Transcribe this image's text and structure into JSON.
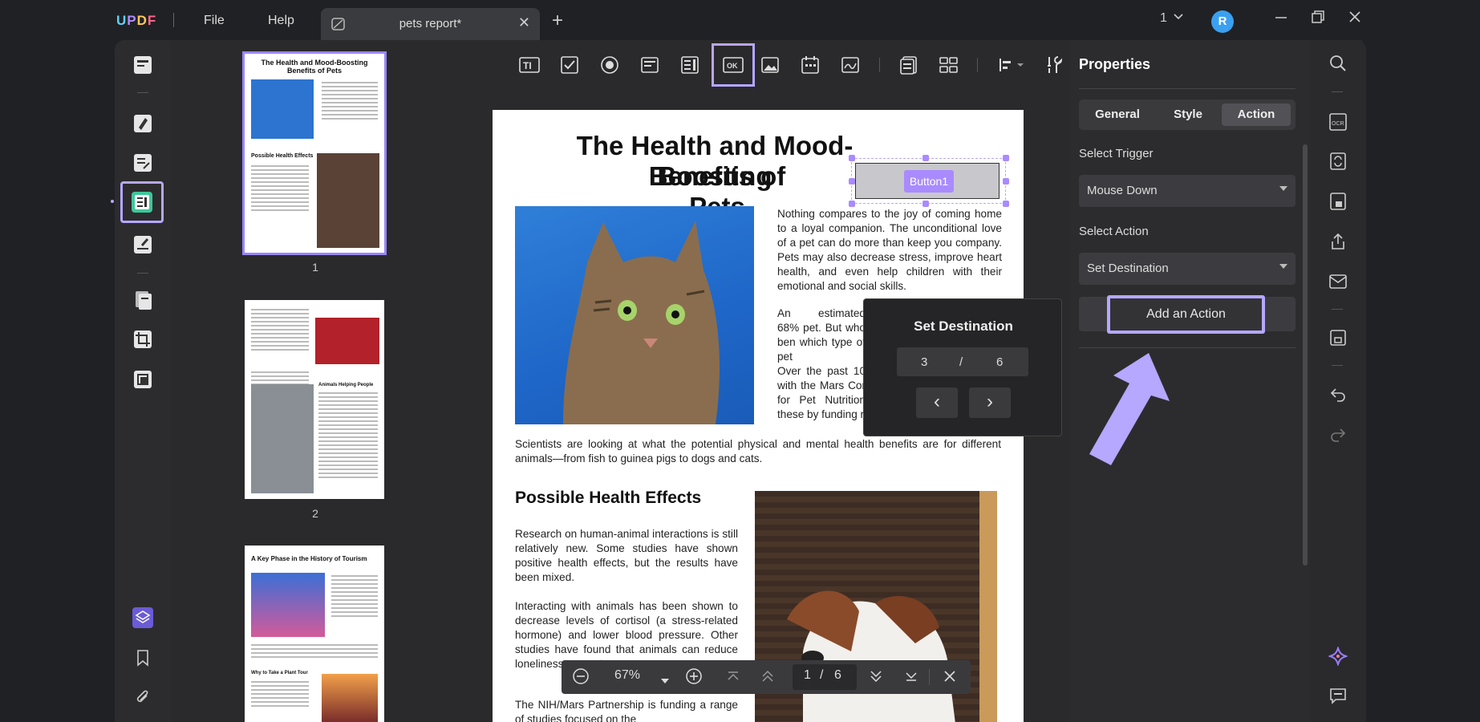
{
  "app": {
    "logo": "UPDF"
  },
  "menu": {
    "file": "File",
    "help": "Help"
  },
  "tab": {
    "title": "pets report*",
    "close": "✕",
    "new": "+"
  },
  "window": {
    "page_indicator": "1",
    "avatar_letter": "R"
  },
  "thumbnails": [
    {
      "page": "1",
      "title": "The Health and Mood-Boosting Benefits of Pets",
      "heading": "Possible Health Effects"
    },
    {
      "page": "2",
      "heading": "Animals Helping People"
    },
    {
      "page": "",
      "title": "A Key Phase in the History of Tourism",
      "heading": "Why to Take a Plant Tour"
    }
  ],
  "document": {
    "title_line1": "The Health and Mood-Boosting",
    "title_line2": "Benefits of Pets",
    "button_field_label": "Button1",
    "intro": "Nothing compares to the joy of coming home to a loyal companion. The unconditional love of a pet can do more than keep you company. Pets may also decrease stress, improve heart health, and even help children with their emotional and social skills.",
    "p2": "An estimated 68% pet. But who ben which type of pet",
    "p3": "Over the past 10 with the Mars Cor for Pet Nutrition these by funding r",
    "p4": "Scientists are looking at what the potential physical and mental health benefits are for different animals—from fish to guinea pigs to dogs and cats.",
    "heading2": "Possible Health Effects",
    "p5": "Research on human-animal interactions is still relatively new. Some studies have shown positive health effects, but the results have been mixed.",
    "p6": "Interacting with animals has been shown to decrease levels of cortisol (a stress-related hormone) and lower blood pressure. Other studies have found that animals can reduce loneliness support, a",
    "p7": "The NIH/Mars Partnership is funding a range of studies focused on the"
  },
  "popup": {
    "title": "Set Destination",
    "current": "3",
    "slash": "/",
    "total": "6",
    "prev": "‹",
    "next": "›"
  },
  "properties": {
    "title": "Properties",
    "tabs": [
      "General",
      "Style",
      "Action"
    ],
    "active_tab": "Action",
    "trigger_label": "Select Trigger",
    "trigger_value": "Mouse Down",
    "action_label": "Select Action",
    "action_value": "Set Destination",
    "add_action": "Add an Action"
  },
  "zoom": {
    "level": "67%",
    "page_current": "1",
    "page_sep": "/",
    "page_total": "6"
  },
  "colors": {
    "accent": "#b6a7ff",
    "highlight_field": "#a98bff",
    "background": "#202124"
  }
}
